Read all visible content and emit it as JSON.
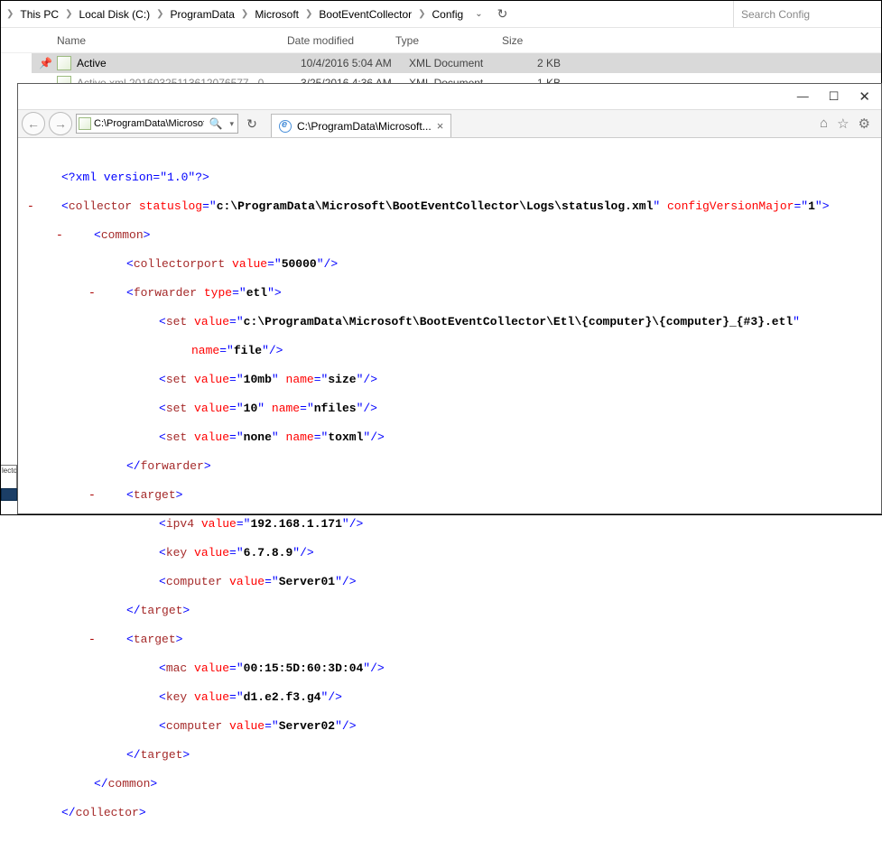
{
  "explorer": {
    "breadcrumbs": [
      "This PC",
      "Local Disk (C:)",
      "ProgramData",
      "Microsoft",
      "BootEventCollector",
      "Config"
    ],
    "search_placeholder": "Search Config",
    "columns": {
      "name": "Name",
      "date": "Date modified",
      "type": "Type",
      "size": "Size"
    },
    "rows": [
      {
        "name": "Active",
        "date": "10/4/2016 5:04 AM",
        "type": "XML Document",
        "size": "2 KB",
        "selected": true
      },
      {
        "name": "Active.xml.20160325113612076577...0",
        "date": "3/25/2016 4:36 AM",
        "type": "XML Document",
        "size": "1 KB",
        "selected": false
      }
    ]
  },
  "ie": {
    "address": "C:\\ProgramData\\Microsoft\\B",
    "tab_title": "C:\\ProgramData\\Microsoft...",
    "xml": {
      "prolog": "<?xml version=\"1.0\"?>",
      "collector_attr_statuslog": "c:\\ProgramData\\Microsoft\\BootEventCollector\\Logs\\statuslog.xml",
      "collector_attr_cfgmajor": "1",
      "collectorport_value": "50000",
      "forwarder_type": "etl",
      "set_file_value": "c:\\ProgramData\\Microsoft\\BootEventCollector\\Etl\\{computer}\\{computer}_{#3}.etl",
      "set_file_name": "file",
      "set_size_value": "10mb",
      "set_size_name": "size",
      "set_nfiles_value": "10",
      "set_nfiles_name": "nfiles",
      "set_toxml_value": "none",
      "set_toxml_name": "toxml",
      "t1_ipv4": "192.168.1.171",
      "t1_key": "6.7.8.9",
      "t1_computer": "Server01",
      "t2_mac": "00:15:5D:60:3D:04",
      "t2_key": "d1.e2.f3.g4",
      "t2_computer": "Server02"
    }
  }
}
